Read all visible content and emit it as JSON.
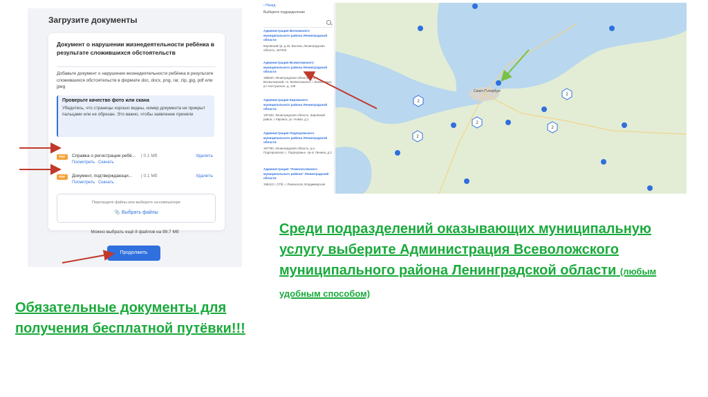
{
  "upload": {
    "title": "Загрузите документы",
    "doc_title": "Документ о нарушении жизнедеятельности ребёнка в результате сложившихся обстоятельств",
    "description": "Добавьте документ о нарушении жизнедеятельности ребёнка в результате сложившихся обстоятельств в формате doc, docx, png, rar, zip, jpg, pdf или jpeg",
    "tip_title": "Проверьте качество фото или скана",
    "tip_text": "Убедитесь, что страницы хорошо видны, номер документа не прикрыт пальцами или не обрезан. Это важно, чтобы заявление приняли",
    "files": [
      {
        "badge": "PDF",
        "name": "Справка о регистрации ребё...",
        "size": "0.1 Мб",
        "delete": "Удалить",
        "view": "Посмотреть",
        "download": "Скачать"
      },
      {
        "badge": "PDF",
        "name": "Документ, подтверждающи...",
        "size": "0.1 Мб",
        "delete": "Удалить",
        "view": "Посмотреть",
        "download": "Скачать"
      }
    ],
    "drop_text": "Перетащите файлы или выберите на компьютере",
    "choose_files": "Выбрать файлы",
    "limit_text": "Можно выбрать ещё 8 файлов на 99.7 Мб",
    "continue_label": "Продолжить"
  },
  "office_list": {
    "back": "‹ Назад",
    "heading": "Выберите подразделение",
    "items": [
      {
        "name": "Администрация Волховского муниципального района Ленинградской области",
        "address": "Кировский пр. д.32, Волхов, Ленинградская область, 187403"
      },
      {
        "name": "Администрация Всеволожского муниципального района Ленинградской области",
        "address": "188640, Ленинградская область, М.р-н Всеволожский, г.п. Всеволожское, г. Всеволожск, ул. Колтушское, д. 138"
      },
      {
        "name": "Администрация Кировского муниципального района Ленинградской области",
        "address": "187340, Ленинградская область, Кировский район, г. Кировск, ул. Новая, д.1"
      },
      {
        "name": "Администрация Подпорожского муниципального района Ленинградской области",
        "address": "187780, Ленинградская область, д.н. Подпорожское, г. Подпорожье, пр-кт Ленина, д.3"
      },
      {
        "name": "Администрация \"Ломоносовского муниципального района\" Ленинградской области",
        "address": "198412 г. СПб, г. Ломоносов, Владимирская"
      }
    ]
  },
  "map": {
    "city_label": "Санкт-Петербург",
    "cluster_counts": [
      "2",
      "2",
      "2",
      "2",
      "2"
    ],
    "colors": {
      "water": "#b9d7ee",
      "land": "#e3edd5",
      "pin": "#2f6fde"
    }
  },
  "captions": {
    "right_main": "Среди подразделений оказывающих муниципальную услугу выберите Администрация Всеволожского муниципального района Ленинградской области",
    "right_small": "(любым удобным способом)",
    "left": "Обязательные документы для получения бесплатной путёвки!!!"
  },
  "colors": {
    "caption_green": "#1aaa3c",
    "arrow_red": "#c0392b",
    "arrow_green": "#7ac142",
    "accent_blue": "#2f6fde"
  }
}
